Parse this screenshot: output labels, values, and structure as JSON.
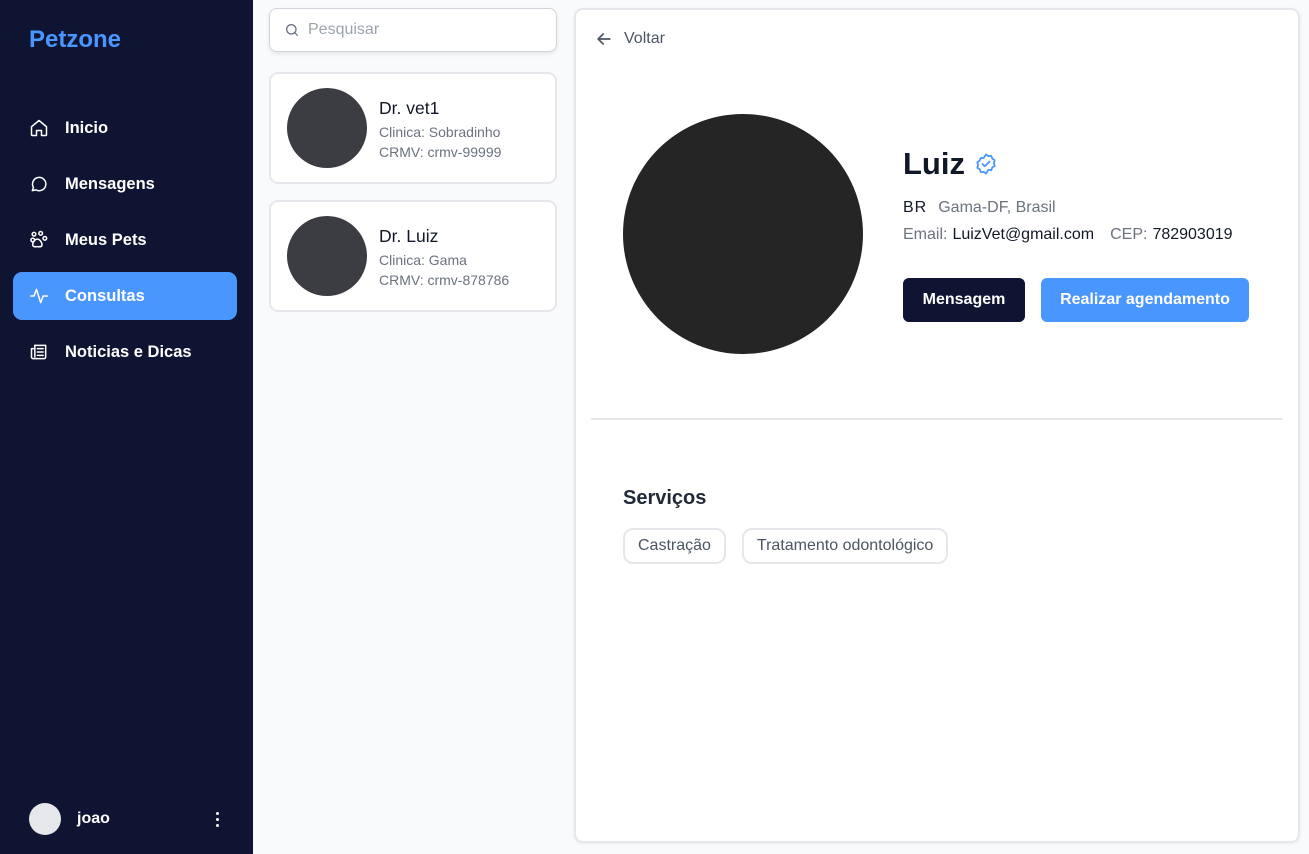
{
  "app": {
    "brand": "Petzone"
  },
  "sidebar": {
    "items": [
      {
        "label": "Inicio",
        "icon": "home-icon",
        "active": false
      },
      {
        "label": "Mensagens",
        "icon": "message-icon",
        "active": false
      },
      {
        "label": "Meus Pets",
        "icon": "paw-icon",
        "active": false
      },
      {
        "label": "Consultas",
        "icon": "activity-icon",
        "active": true
      },
      {
        "label": "Noticias e Dicas",
        "icon": "newspaper-icon",
        "active": false
      }
    ],
    "user": {
      "name": "joao"
    }
  },
  "search": {
    "placeholder": "Pesquisar",
    "value": ""
  },
  "vets": [
    {
      "name": "Dr. vet1",
      "clinic": "Clinica: Sobradinho",
      "crmv": "CRMV: crmv-99999"
    },
    {
      "name": "Dr. Luiz",
      "clinic": "Clinica: Gama",
      "crmv": "CRMV: crmv-878786"
    }
  ],
  "detail": {
    "back_label": "Voltar",
    "name": "Luiz",
    "country": "BR",
    "location": "Gama-DF, Brasil",
    "email_label": "Email:",
    "email": "LuizVet@gmail.com",
    "cep_label": "CEP:",
    "cep": "782903019",
    "message_button": "Mensagem",
    "schedule_button": "Realizar agendamento",
    "services_title": "Serviços",
    "services": [
      "Castração",
      "Tratamento odontológico"
    ]
  },
  "colors": {
    "sidebar_bg": "#0f1433",
    "accent": "#4a96ff",
    "dark_button": "#0f1433"
  }
}
